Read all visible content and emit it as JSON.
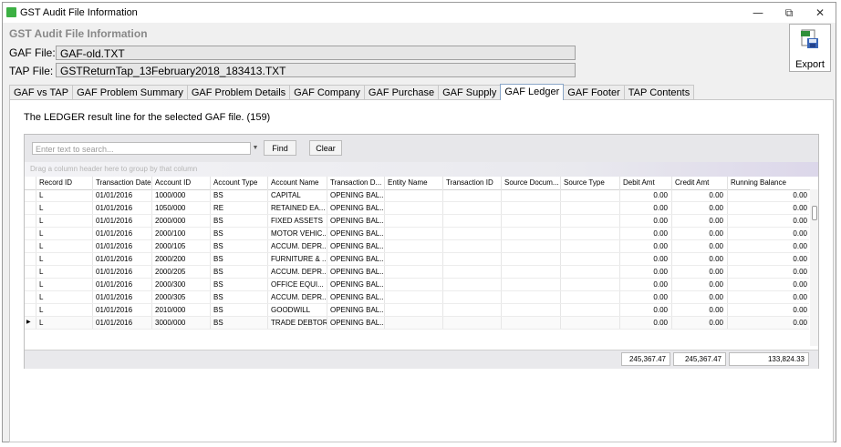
{
  "window": {
    "title": "GST Audit File Information",
    "min": "—",
    "max": "⧉",
    "close": "✕"
  },
  "header": {
    "title": "GST Audit File Information",
    "gaf_label": "GAF File:",
    "gaf_value": "GAF-old.TXT",
    "tap_label": "TAP File:",
    "tap_value": "GSTReturnTap_13February2018_183413.TXT",
    "export_label": "Export"
  },
  "tabs": [
    "GAF vs TAP",
    "GAF Problem Summary",
    "GAF Problem Details",
    "GAF Company",
    "GAF Purchase",
    "GAF Supply",
    "GAF Ledger",
    "GAF Footer",
    "TAP Contents"
  ],
  "active_tab": "GAF Ledger",
  "panel": {
    "description": "The LEDGER result line for the selected GAF file. (159)"
  },
  "search": {
    "placeholder": "Enter text to search...",
    "find": "Find",
    "clear": "Clear"
  },
  "group_hint": "Drag a column header here to group by that column",
  "columns": [
    "Record ID",
    "Transaction Date",
    "Account ID",
    "Account Type",
    "Account Name",
    "Transaction D...",
    "Entity Name",
    "Transaction ID",
    "Source Docum...",
    "Source Type",
    "Debit Amt",
    "Credit Amt",
    "Running Balance"
  ],
  "rows": [
    [
      "L",
      "01/01/2016",
      "1000/000",
      "BS",
      "CAPITAL",
      "OPENING BAL...",
      "",
      "",
      "",
      "",
      "0.00",
      "0.00",
      "0.00"
    ],
    [
      "L",
      "01/01/2016",
      "1050/000",
      "RE",
      "RETAINED EA...",
      "OPENING BAL...",
      "",
      "",
      "",
      "",
      "0.00",
      "0.00",
      "0.00"
    ],
    [
      "L",
      "01/01/2016",
      "2000/000",
      "BS",
      "FIXED ASSETS",
      "OPENING BAL...",
      "",
      "",
      "",
      "",
      "0.00",
      "0.00",
      "0.00"
    ],
    [
      "L",
      "01/01/2016",
      "2000/100",
      "BS",
      "MOTOR VEHIC...",
      "OPENING BAL...",
      "",
      "",
      "",
      "",
      "0.00",
      "0.00",
      "0.00"
    ],
    [
      "L",
      "01/01/2016",
      "2000/105",
      "BS",
      "ACCUM. DEPR...",
      "OPENING BAL...",
      "",
      "",
      "",
      "",
      "0.00",
      "0.00",
      "0.00"
    ],
    [
      "L",
      "01/01/2016",
      "2000/200",
      "BS",
      "FURNITURE & ...",
      "OPENING BAL...",
      "",
      "",
      "",
      "",
      "0.00",
      "0.00",
      "0.00"
    ],
    [
      "L",
      "01/01/2016",
      "2000/205",
      "BS",
      "ACCUM. DEPR...",
      "OPENING BAL...",
      "",
      "",
      "",
      "",
      "0.00",
      "0.00",
      "0.00"
    ],
    [
      "L",
      "01/01/2016",
      "2000/300",
      "BS",
      "OFFICE EQUI...",
      "OPENING BAL...",
      "",
      "",
      "",
      "",
      "0.00",
      "0.00",
      "0.00"
    ],
    [
      "L",
      "01/01/2016",
      "2000/305",
      "BS",
      "ACCUM. DEPR...",
      "OPENING BAL...",
      "",
      "",
      "",
      "",
      "0.00",
      "0.00",
      "0.00"
    ],
    [
      "L",
      "01/01/2016",
      "2010/000",
      "BS",
      "GOODWILL",
      "OPENING BAL...",
      "",
      "",
      "",
      "",
      "0.00",
      "0.00",
      "0.00"
    ],
    [
      "L",
      "01/01/2016",
      "3000/000",
      "BS",
      "TRADE DEBTORS",
      "OPENING BAL...",
      "",
      "",
      "",
      "",
      "0.00",
      "0.00",
      "0.00"
    ]
  ],
  "selected_row": 10,
  "row_indicator": "▶",
  "totals": {
    "debit": "245,367.47",
    "credit": "245,367.47",
    "running": "133,824.33"
  },
  "colors": {
    "tab_active_border": "#8aa6c8",
    "grid_border": "#bfbfbf"
  }
}
